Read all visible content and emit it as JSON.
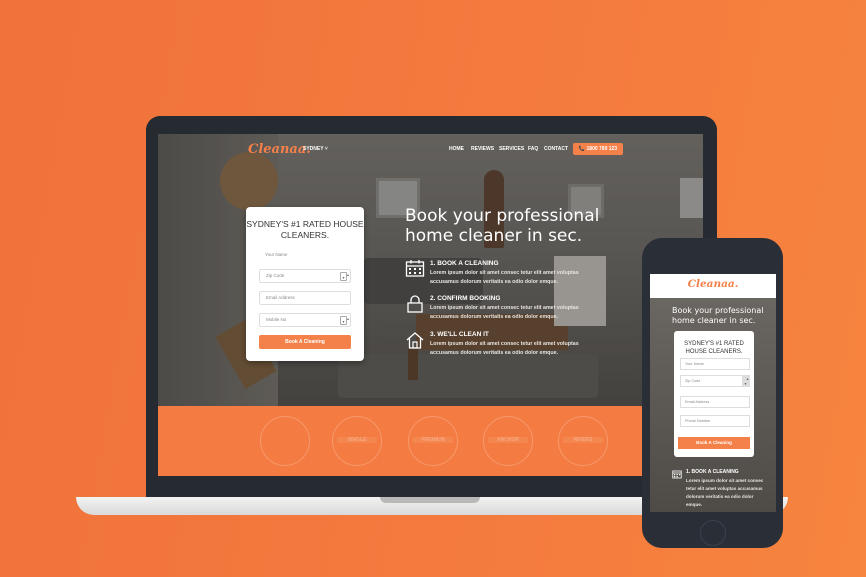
{
  "colors": {
    "accent": "#f5814a",
    "background": "#f47a3e",
    "device": "#262a31"
  },
  "laptop": {
    "logo": "Cleanaa.",
    "city": "SYDNEY ˅",
    "nav": [
      "HOME",
      "REVIEWS",
      "SERVICES",
      "FAQ",
      "CONTACT"
    ],
    "phone": "📞 1800 789 123",
    "hero_title": "Book your professional home cleaner in sec.",
    "steps": [
      {
        "icon": "calendar-icon",
        "title": "1. BOOK A CLEANING",
        "text": "Lorem ipsum dolor sit amet consec tetur elit amet voluptas accusamus dolorum veritatis ea odio dolor emque."
      },
      {
        "icon": "lock-icon",
        "title": "2. CONFIRM BOOKING",
        "text": "Lorem ipsum dolor sit amet consec tetur elit amet voluptas accusamus dolorum veritatis ea odio dolor emque."
      },
      {
        "icon": "home-icon",
        "title": "3. WE'LL CLEAN IT",
        "text": "Lorem ipsum dolor sit amet consec tetur elit amet voluptas accusamus dolorum veritatis ea odio dolor emque."
      }
    ],
    "form": {
      "title": "SYDNEY'S #1 RATED HOUSE CLEANERS.",
      "fields": [
        "Your Name",
        "Zip Code",
        "Email Address",
        "Mobile No"
      ],
      "button": "Book A Cleaning"
    },
    "badges": [
      "",
      "SINGLE",
      "PREMIUM",
      "ANCHOR",
      "RIVERS"
    ]
  },
  "phone": {
    "logo": "Cleanaa.",
    "hero_title": "Book your professional home cleaner in sec.",
    "form": {
      "title": "SYDNEY'S #1 RATED HOUSE CLEANERS.",
      "fields": [
        "Your Name",
        "Zip Code",
        "Email Address",
        "Phone Number"
      ],
      "button": "Book A Cleaning"
    },
    "step": {
      "icon": "calendar-icon",
      "title": "1. BOOK A CLEANING",
      "text": "Lorem ipsum dolor sit amet consec tetur elit amet voluptas accusamus dolorum veritatis ea odio dolor emque."
    }
  }
}
